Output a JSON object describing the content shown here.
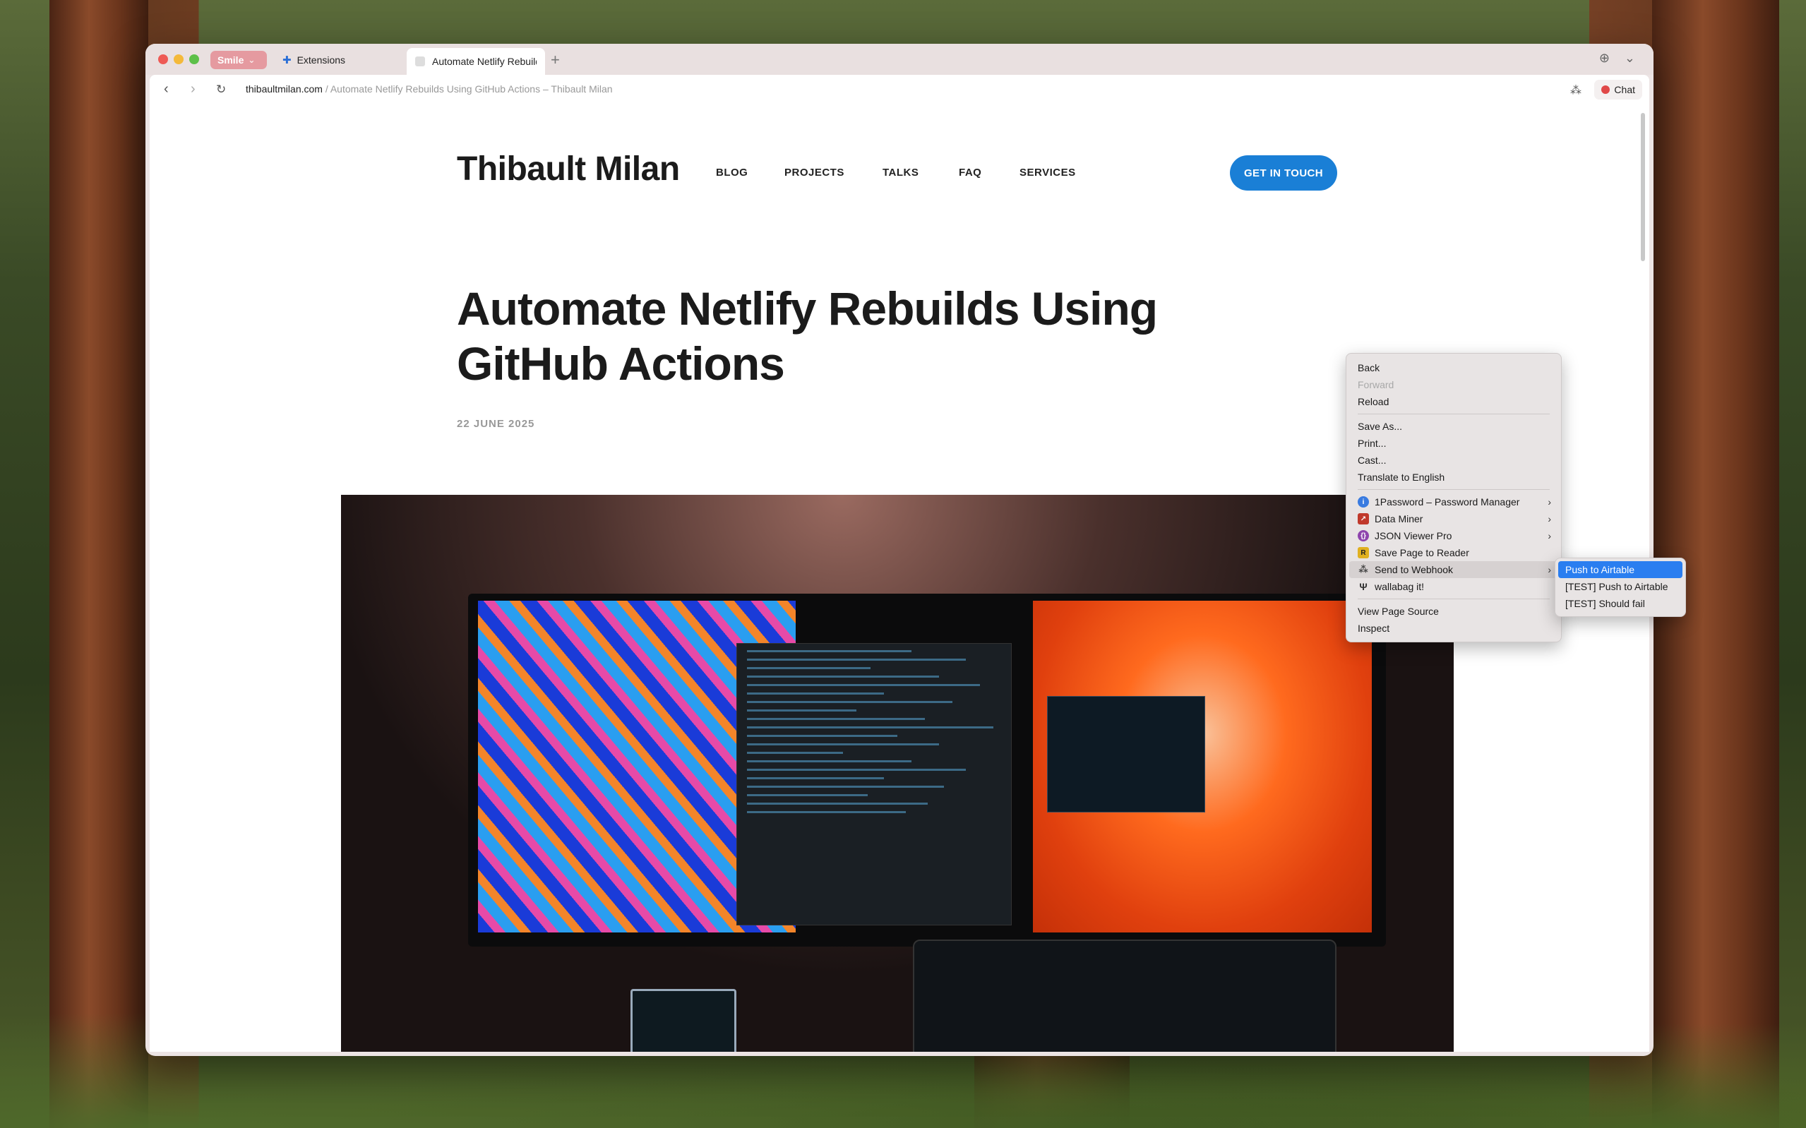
{
  "browser": {
    "profile_label": "Smile",
    "tabs": [
      {
        "label": "Extensions"
      },
      {
        "label": "Automate Netlify Rebuilds"
      }
    ],
    "new_tab_symbol": "+",
    "url_host": "thibaultmilan.com",
    "url_rest": " / Automate Netlify Rebuilds Using GitHub Actions – Thibault Milan",
    "chat_label": "Chat",
    "icons": [
      "back-icon",
      "forward-icon",
      "reload-icon",
      "download-icon",
      "tab-list-icon",
      "webhook-icon",
      "chat-icon"
    ]
  },
  "site": {
    "title": "Thibault Milan",
    "nav": [
      "BLOG",
      "PROJECTS",
      "TALKS",
      "FAQ",
      "SERVICES"
    ],
    "cta": "GET IN TOUCH"
  },
  "article": {
    "title": "Automate Netlify Rebuilds Using GitHub Actions",
    "date": "22 JUNE 2025"
  },
  "context_menu": {
    "items": [
      {
        "label": "Back"
      },
      {
        "label": "Forward",
        "disabled": true
      },
      {
        "label": "Reload"
      },
      {
        "label": "Save As..."
      },
      {
        "label": "Print..."
      },
      {
        "label": "Cast..."
      },
      {
        "label": "Translate to English"
      },
      {
        "label": "1Password – Password Manager",
        "submenu": true,
        "icon_color": "#3a7be0"
      },
      {
        "label": "Data Miner",
        "submenu": true,
        "icon_color": "#c0392b"
      },
      {
        "label": "JSON Viewer Pro",
        "submenu": true,
        "icon_color": "#8e44ad"
      },
      {
        "label": "Save Page to Reader",
        "icon_color": "#e0b020"
      },
      {
        "label": "Send to Webhook",
        "submenu": true,
        "highlighted": true
      },
      {
        "label": "wallabag it!"
      },
      {
        "label": "View Page Source"
      },
      {
        "label": "Inspect"
      }
    ],
    "submenu": [
      {
        "label": "Push to Airtable",
        "active": true
      },
      {
        "label": "[TEST] Push to Airtable"
      },
      {
        "label": "[TEST] Should fail"
      }
    ]
  }
}
